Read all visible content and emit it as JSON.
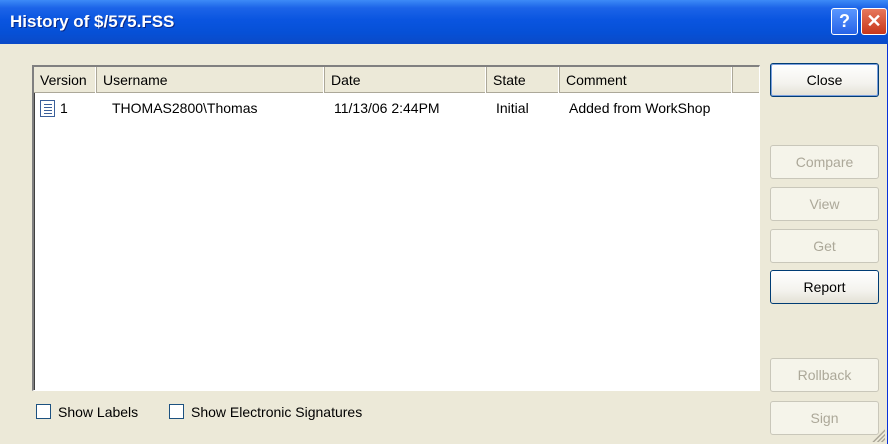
{
  "window": {
    "title": "History of $/575.FSS",
    "help_glyph": "?",
    "close_glyph": "✕"
  },
  "list": {
    "columns": [
      "Version",
      "Username",
      "Date",
      "State",
      "Comment"
    ],
    "rows": [
      {
        "icon": "document-icon",
        "version": "1",
        "username": "THOMAS2800\\Thomas",
        "date": "11/13/06 2:44PM",
        "state": "Initial",
        "comment": "Added from WorkShop"
      }
    ]
  },
  "buttons": {
    "close": "Close",
    "compare": "Compare",
    "view": "View",
    "get": "Get",
    "report": "Report",
    "rollback": "Rollback",
    "sign": "Sign"
  },
  "options": {
    "show_labels": {
      "label": "Show Labels",
      "checked": false
    },
    "show_signatures": {
      "label": "Show Electronic Signatures",
      "checked": false
    }
  },
  "colors": {
    "titlebar": "#0a55e0",
    "face": "#ece9d8",
    "disabled_text": "#aca899"
  }
}
